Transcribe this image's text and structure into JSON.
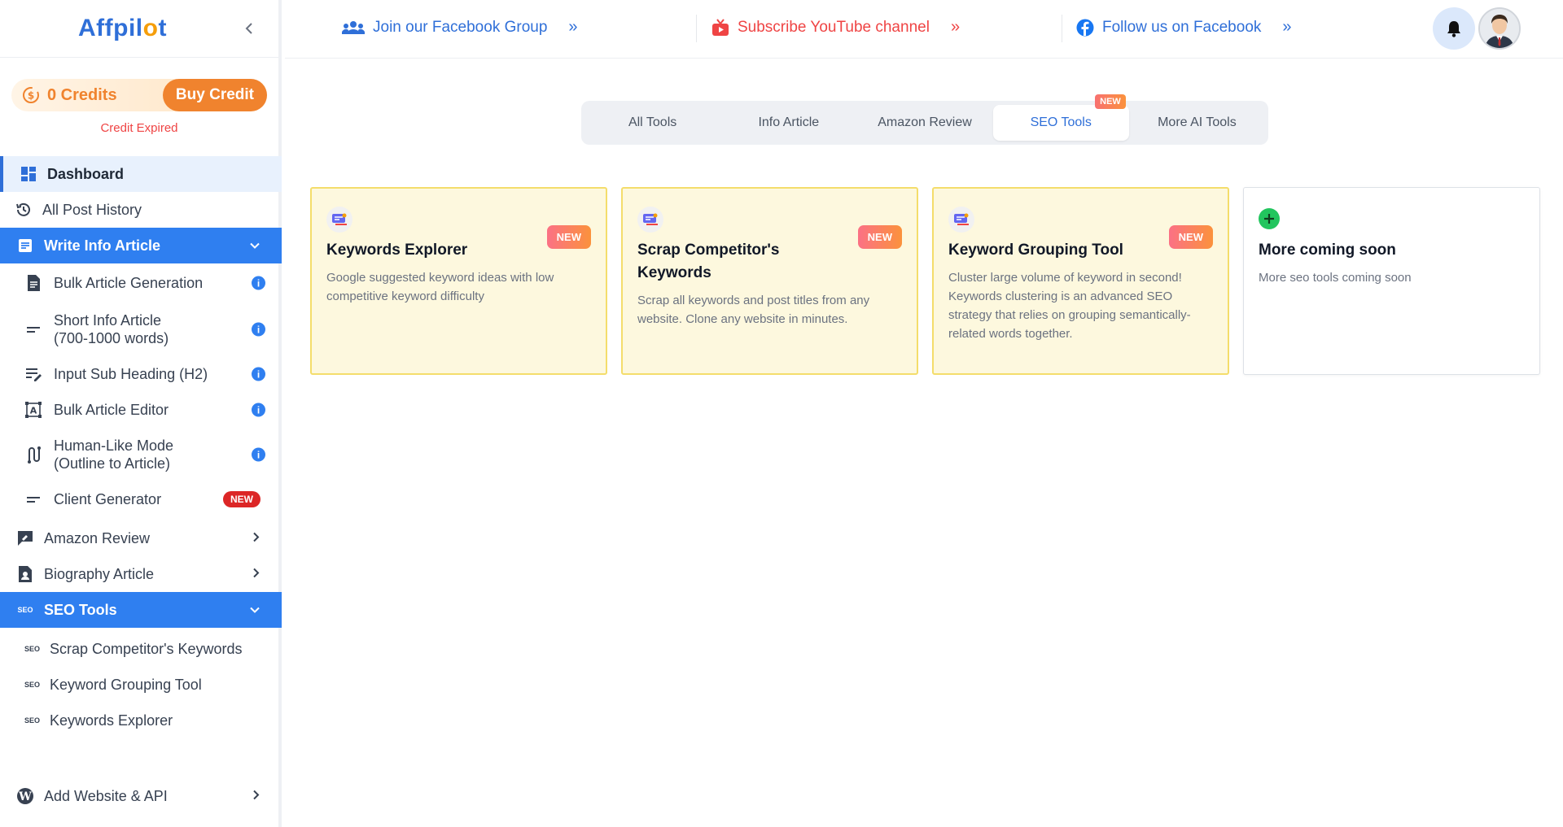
{
  "app": {
    "logo_prefix": "Affpil",
    "logo_dot": "o",
    "logo_suffix": "t"
  },
  "colors": {
    "primary": "#2f7ff0",
    "accent": "#f0832e",
    "danger": "#dc2626",
    "card_bg": "#fdf8de",
    "card_border": "#f4dd6b"
  },
  "credits": {
    "amount_label": "0 Credits",
    "buy_label": "Buy Credit",
    "status": "Credit Expired"
  },
  "sidebar": {
    "dashboard": "Dashboard",
    "history": "All Post History",
    "write_info": "Write Info Article",
    "write_items": [
      {
        "label": "Bulk Article Generation",
        "icon": "document-icon"
      },
      {
        "label": "Short Info Article",
        "label2": "(700-1000 words)",
        "icon": "short-text-icon"
      },
      {
        "label": "Input Sub Heading (H2)",
        "icon": "edit-list-icon"
      },
      {
        "label": "Bulk Article Editor",
        "icon": "text-frame-icon"
      },
      {
        "label": "Human-Like Mode",
        "label2": "(Outline to Article)",
        "icon": "route-icon"
      },
      {
        "label": "Client Generator",
        "icon": "short-text-icon",
        "badge": "NEW"
      }
    ],
    "amazon": "Amazon Review",
    "biography": "Biography Article",
    "seo": "SEO Tools",
    "seo_tag": "SEO",
    "seo_items": [
      "Scrap Competitor's Keywords",
      "Keyword Grouping Tool",
      "Keywords Explorer"
    ],
    "add_website": "Add Website & API"
  },
  "topbar": {
    "facebook_group": "Join our Facebook Group",
    "youtube": "Subscribe YouTube channel",
    "follow_facebook": "Follow us on Facebook",
    "arrows": "»"
  },
  "tabs": [
    {
      "label": "All Tools"
    },
    {
      "label": "Info Article"
    },
    {
      "label": "Amazon Review"
    },
    {
      "label": "SEO Tools",
      "badge": "NEW"
    },
    {
      "label": "More AI Tools"
    }
  ],
  "cards": [
    {
      "title": "Keywords Explorer",
      "desc": "Google suggested keyword ideas with low competitive keyword difficulty",
      "badge": "NEW"
    },
    {
      "title": "Scrap Competitor's Keywords",
      "desc": "Scrap all keywords and post titles from any website. Clone any website in minutes.",
      "badge": "NEW"
    },
    {
      "title": "Keyword Grouping Tool",
      "desc": "Cluster large volume of keyword in second! Keywords clustering is an advanced SEO strategy that relies on grouping semantically-related words together.",
      "badge": "NEW"
    },
    {
      "title": "More coming soon",
      "desc": "More seo tools coming soon"
    }
  ]
}
